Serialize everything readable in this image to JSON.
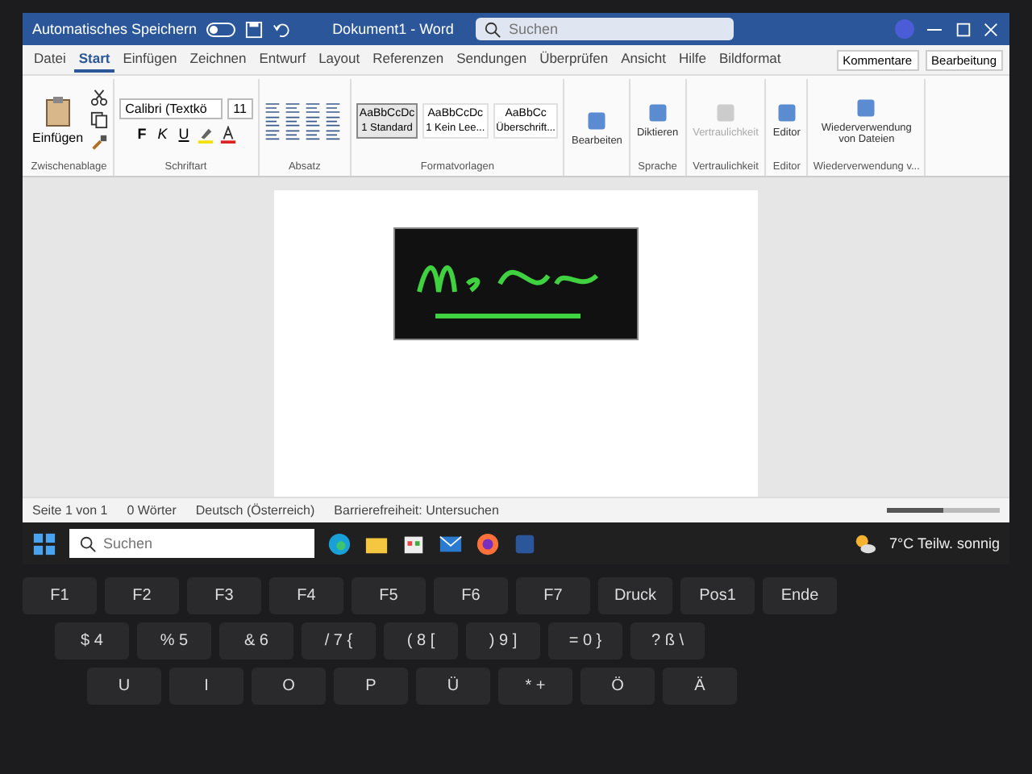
{
  "title_bar": {
    "autosave_label": "Automatisches Speichern",
    "autosave_on": false,
    "document_title": "Dokument1 - Word",
    "search_placeholder": "Suchen"
  },
  "ribbon_tabs": [
    {
      "label": "Datei",
      "selected": false
    },
    {
      "label": "Start",
      "selected": true
    },
    {
      "label": "Einfügen",
      "selected": false
    },
    {
      "label": "Zeichnen",
      "selected": false
    },
    {
      "label": "Entwurf",
      "selected": false
    },
    {
      "label": "Layout",
      "selected": false
    },
    {
      "label": "Referenzen",
      "selected": false
    },
    {
      "label": "Sendungen",
      "selected": false
    },
    {
      "label": "Überprüfen",
      "selected": false
    },
    {
      "label": "Ansicht",
      "selected": false
    },
    {
      "label": "Hilfe",
      "selected": false
    },
    {
      "label": "Bildformat",
      "selected": false
    }
  ],
  "header_actions": [
    "Kommentare",
    "Bearbeitung"
  ],
  "clipboard": {
    "paste_label": "Einfügen",
    "group_label": "Zwischenablage"
  },
  "font": {
    "name": "Calibri (Textkö",
    "size": "11",
    "format_buttons": [
      "F",
      "K",
      "U"
    ],
    "group_label": "Schriftart"
  },
  "paragraph": {
    "group_label": "Absatz"
  },
  "styles": {
    "group_label": "Formatvorlagen",
    "items": [
      {
        "preview": "AaBbCcDc",
        "name": "1 Standard",
        "selected": true
      },
      {
        "preview": "AaBbCcDc",
        "name": "1 Kein Lee...",
        "selected": false
      },
      {
        "preview": "AaBbCc",
        "name": "Überschrift...",
        "selected": false
      }
    ]
  },
  "command_groups": [
    {
      "buttons": [
        {
          "label": "Bearbeiten",
          "disabled": false
        }
      ]
    },
    {
      "group_label": "Sprache",
      "buttons": [
        {
          "label": "Diktieren",
          "disabled": false
        }
      ]
    },
    {
      "group_label": "Vertraulichkeit",
      "buttons": [
        {
          "label": "Vertraulichkeit",
          "disabled": true
        }
      ]
    },
    {
      "group_label": "Editor",
      "buttons": [
        {
          "label": "Editor",
          "disabled": false
        }
      ]
    },
    {
      "group_label": "Wiederverwendung v...",
      "buttons": [
        {
          "label": "Wiederverwendung von Dateien",
          "disabled": false
        }
      ]
    }
  ],
  "status_bar": {
    "items": [
      "Seite 1 von 1",
      "0 Wörter",
      "Deutsch (Österreich)",
      "Barrierefreiheit: Untersuchen"
    ],
    "zoom": {
      "level": 0.5
    }
  },
  "taskbar": {
    "search_placeholder": "Suchen",
    "weather": "7°C Teilw. sonnig"
  },
  "keyboard": {
    "rows": [
      [
        "F1",
        "F2",
        "F3",
        "F4",
        "F5",
        "F6",
        "F7",
        "Druck",
        "Pos1",
        "Ende"
      ],
      [
        "$ 4",
        "% 5",
        "& 6",
        "/ 7 {",
        "( 8 [",
        ") 9 ]",
        "= 0 }",
        "? ß \\"
      ],
      [
        "U",
        "I",
        "O",
        "P",
        "Ü",
        "* +",
        "Ö",
        "Ä"
      ]
    ]
  }
}
